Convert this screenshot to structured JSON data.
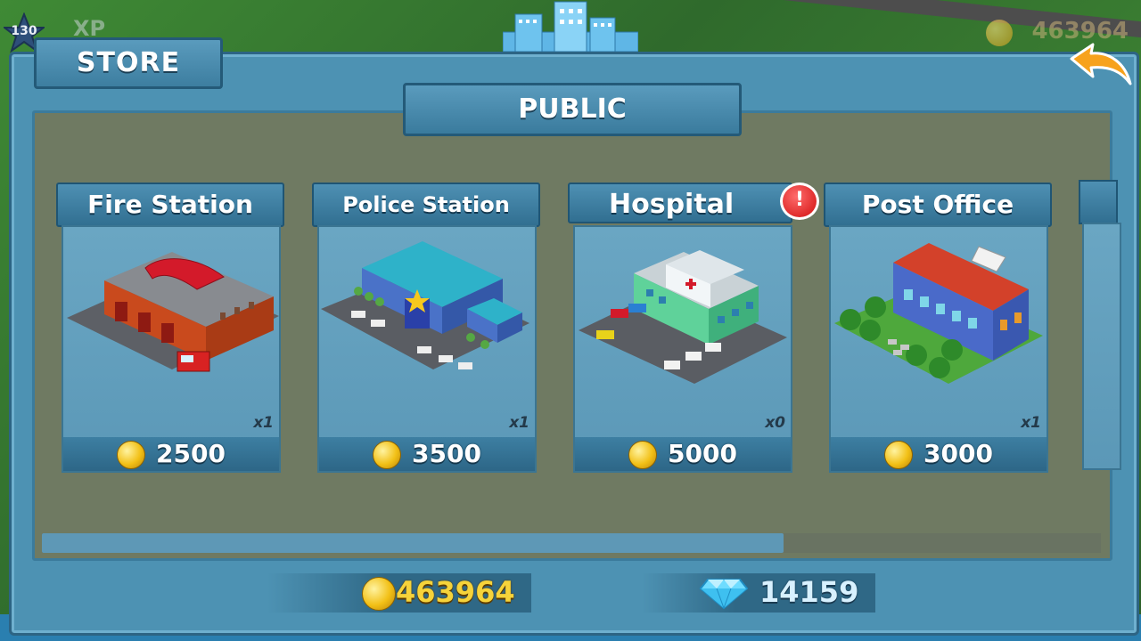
{
  "hud": {
    "level": "130",
    "xp_label": "XP",
    "coins": "463964"
  },
  "store": {
    "title": "STORE",
    "category": "PUBLIC",
    "items": [
      {
        "name": "Fire Station",
        "count": "x1",
        "price": "2500",
        "alert": ""
      },
      {
        "name": "Police Station",
        "count": "x1",
        "price": "3500",
        "alert": ""
      },
      {
        "name": "Hospital",
        "count": "x0",
        "price": "5000",
        "alert": "!"
      },
      {
        "name": "Post Office",
        "count": "x1",
        "price": "3000",
        "alert": ""
      }
    ],
    "scroll_fraction": 0.7
  },
  "wallet": {
    "coins": "463964",
    "gems": "14159"
  },
  "colors": {
    "panel": "#4d92b3",
    "content": "#6f7a62",
    "coin_text": "#f6d33a",
    "gem_text": "#d8f1ff"
  }
}
